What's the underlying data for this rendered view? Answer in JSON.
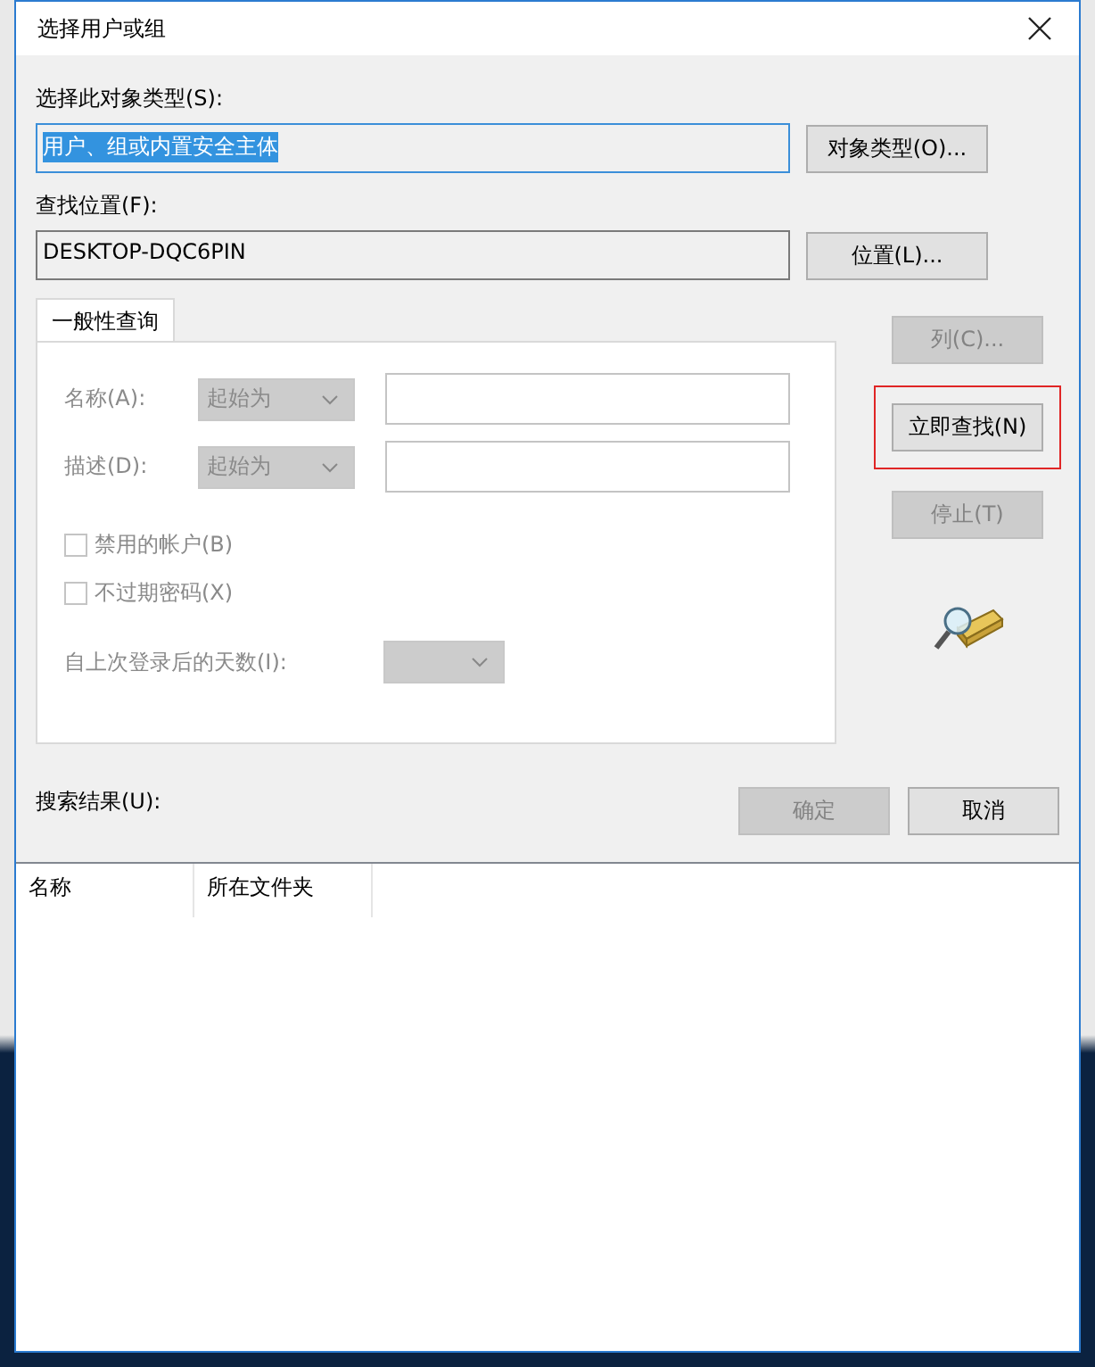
{
  "window": {
    "title": "选择用户或组"
  },
  "object_type": {
    "label": "选择此对象类型(S):",
    "value": "用户、组或内置安全主体",
    "value_selected": true,
    "button": "对象类型(O)..."
  },
  "location": {
    "label": "查找位置(F):",
    "value": "DESKTOP-DQC6PIN",
    "button": "位置(L)..."
  },
  "tabs": [
    {
      "label": "一般性查询",
      "selected": true
    }
  ],
  "query": {
    "disabled": true,
    "rows": [
      {
        "label": "名称(A):",
        "mode": "起始为"
      },
      {
        "label": "描述(D):",
        "mode": "起始为"
      }
    ],
    "checkboxes": [
      {
        "label": "禁用的帐户(B)",
        "checked": false
      },
      {
        "label": "不过期密码(X)",
        "checked": false
      }
    ],
    "days_label": "自上次登录后的天数(I):"
  },
  "side_buttons": [
    {
      "label": "列(C)...",
      "disabled": true,
      "highlighted": false
    },
    {
      "label": "立即查找(N)",
      "disabled": false,
      "highlighted": true
    },
    {
      "label": "停止(T)",
      "disabled": true,
      "highlighted": false
    }
  ],
  "dialog_buttons": [
    {
      "label": "确定",
      "disabled": true
    },
    {
      "label": "取消",
      "disabled": false
    }
  ],
  "results": {
    "label": "搜索结果(U):",
    "columns": [
      "名称",
      "所在文件夹"
    ]
  }
}
